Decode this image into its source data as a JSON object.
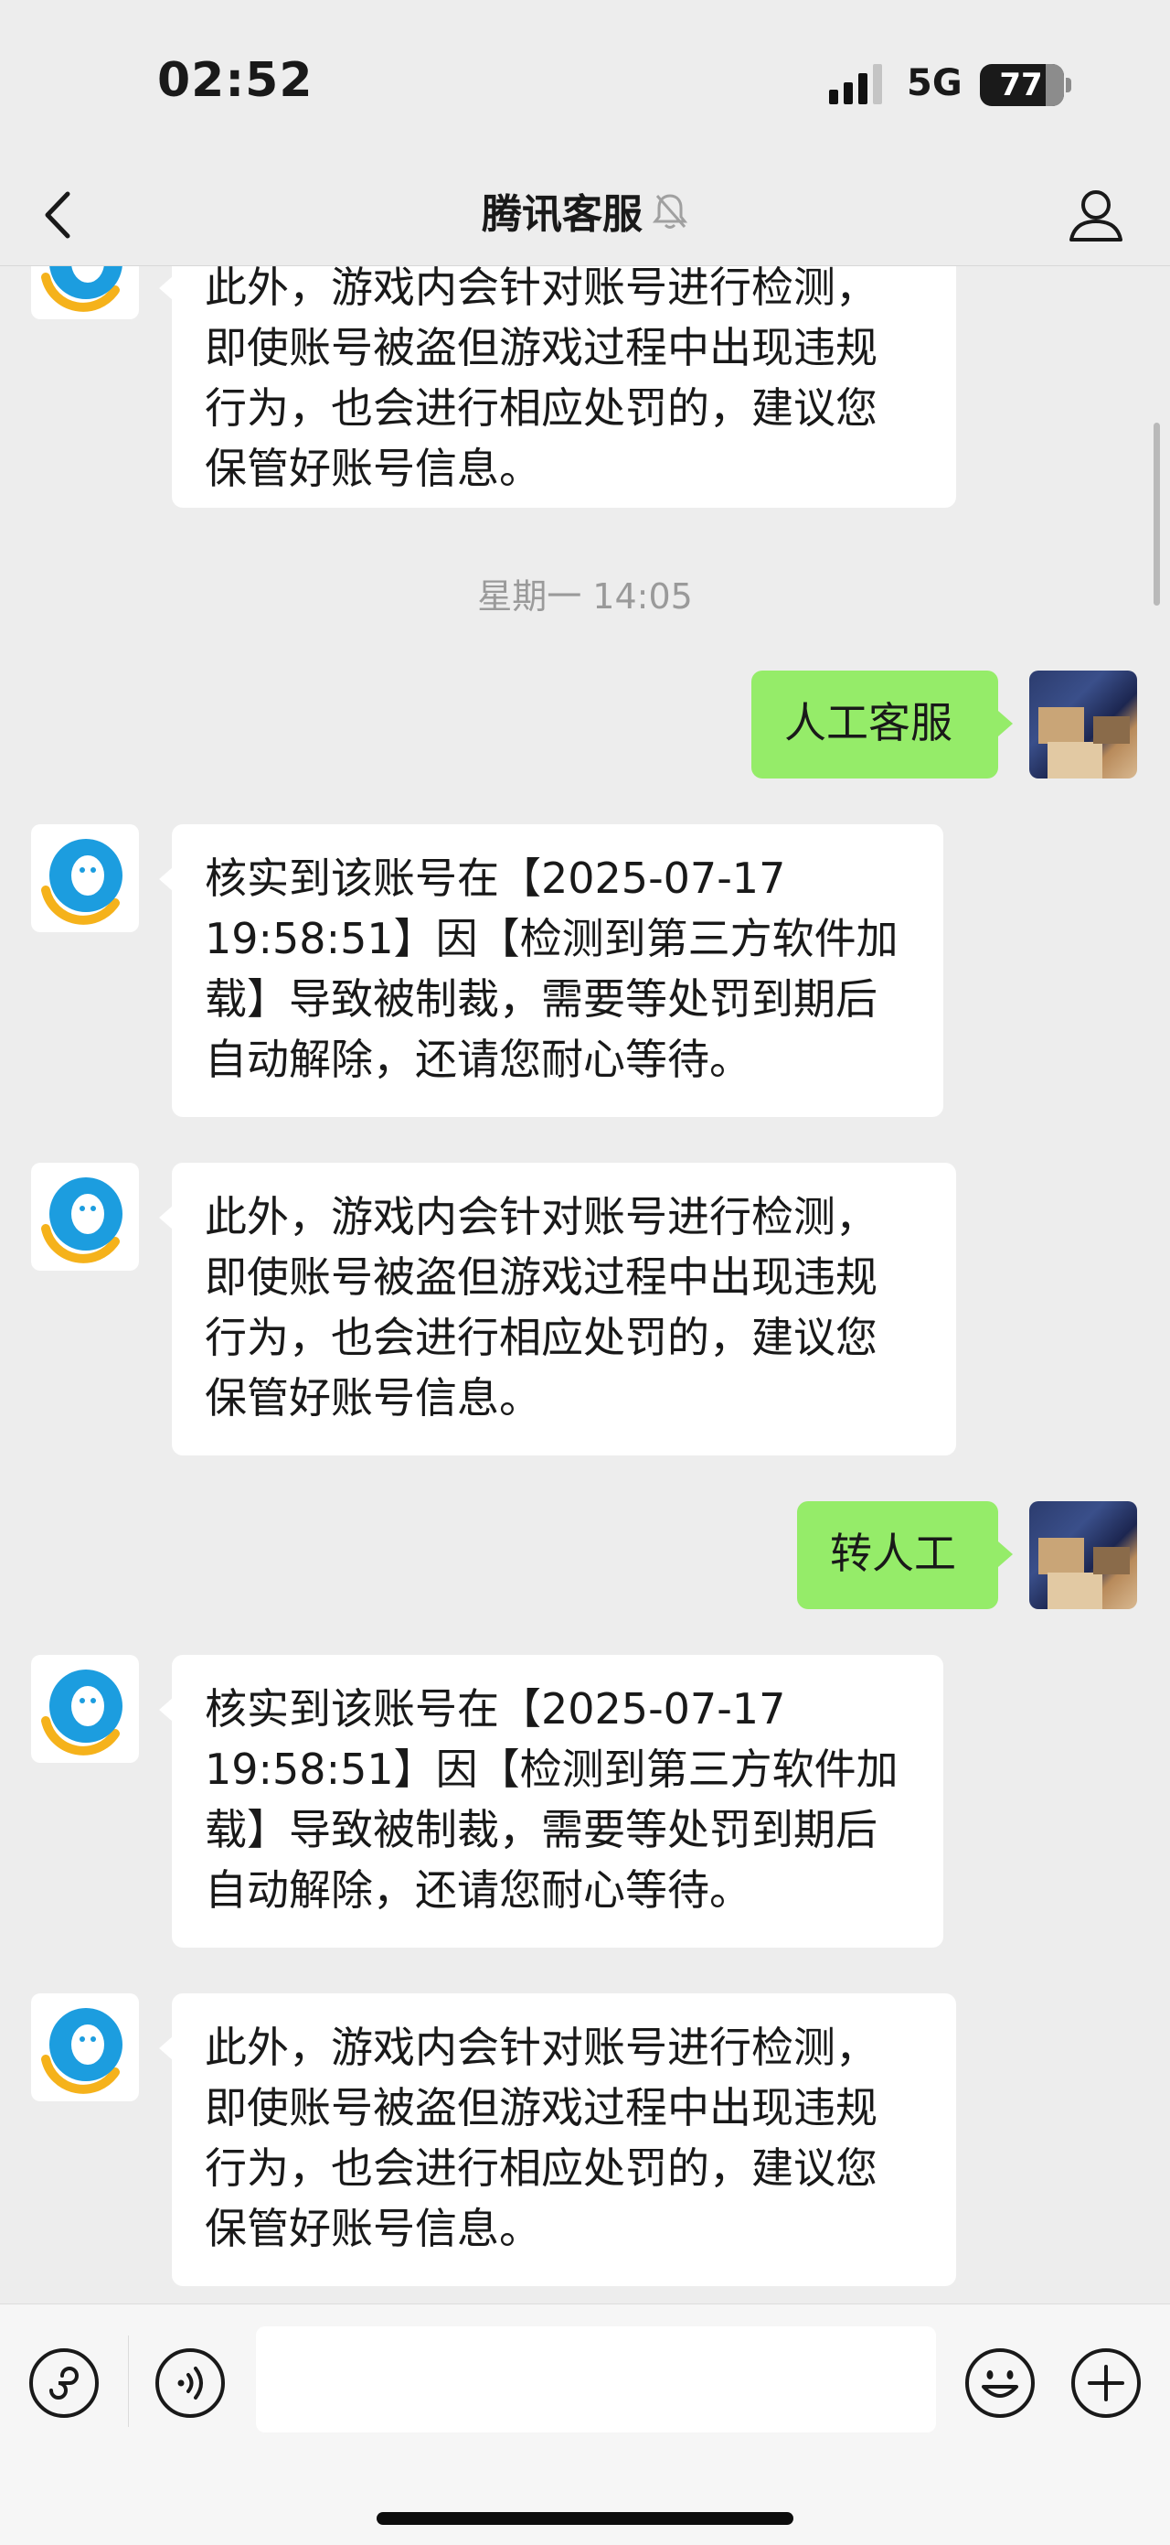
{
  "status_bar": {
    "time": "02:52",
    "network": "5G",
    "battery": "77"
  },
  "header": {
    "title": "腾讯客服"
  },
  "messages": {
    "m0": "此外，游戏内会针对账号进行检测，\n即使账号被盗但游戏过程中出现违规\n行为，也会进行相应处罚的，建议您\n保管好账号信息。",
    "ts": "星期一 14:05",
    "u1": "人工客服",
    "m1": "核实到该账号在【2025-07-17\n19:58:51】因【检测到第三方软件加\n载】导致被制裁，需要等处罚到期后\n自动解除，还请您耐心等待。",
    "m2": "此外，游戏内会针对账号进行检测，\n即使账号被盗但游戏过程中出现违规\n行为，也会进行相应处罚的，建议您\n保管好账号信息。",
    "u2": "转人工",
    "m3": "核实到该账号在【2025-07-17\n19:58:51】因【检测到第三方软件加\n载】导致被制裁，需要等处罚到期后\n自动解除，还请您耐心等待。",
    "m4": "此外，游戏内会针对账号进行检测，\n即使账号被盗但游戏过程中出现违规\n行为，也会进行相应处罚的，建议您\n保管好账号信息。"
  },
  "input": {
    "value": ""
  },
  "colors": {
    "user_bubble": "#95ec69",
    "bot_bubble": "#ffffff",
    "background": "#ededed"
  },
  "icons": [
    "chevron-left-icon",
    "mute-bell-icon",
    "profile-icon",
    "mini-program-icon",
    "voice-icon",
    "emoji-icon",
    "plus-icon"
  ]
}
